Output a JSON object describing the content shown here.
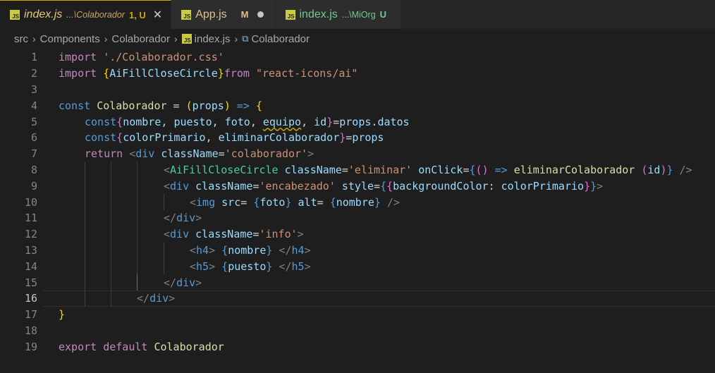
{
  "tabs": [
    {
      "file": "index.js",
      "path": "...\\Colaborador",
      "status": "1, U",
      "active": true
    },
    {
      "file": "App.js",
      "status": "M",
      "active": false
    },
    {
      "file": "index.js",
      "path": "...\\MiOrg",
      "status": "U",
      "active": false
    }
  ],
  "breadcrumb": [
    "src",
    "Components",
    "Colaborador",
    "index.js",
    "Colaborador"
  ],
  "line_numbers": [
    "1",
    "2",
    "3",
    "4",
    "5",
    "6",
    "7",
    "8",
    "9",
    "10",
    "11",
    "12",
    "13",
    "14",
    "15",
    "16",
    "17",
    "18",
    "19"
  ],
  "current_line": "16",
  "code": {
    "l1": [
      "import",
      " ",
      "'./Colaborador.css'"
    ],
    "l2": [
      "import",
      " ",
      "{",
      "AiFillCloseCircle",
      "}",
      "from",
      " ",
      "\"react-icons/ai\""
    ],
    "l4": [
      "const",
      " ",
      "Colaborador",
      " = ",
      "(",
      "props",
      ")",
      " ",
      "=>",
      " ",
      "{"
    ],
    "l5": [
      "const",
      "{",
      "nombre",
      ", ",
      "puesto",
      ", ",
      "foto",
      ", ",
      "equipo",
      ", ",
      "id",
      "}",
      "=",
      "props",
      ".",
      "datos"
    ],
    "l6": [
      "const",
      "{",
      "colorPrimario",
      ", ",
      "eliminarColaborador",
      "}",
      "=",
      "props"
    ],
    "l7": [
      "return",
      " ",
      "<",
      "div",
      " ",
      "className",
      "=",
      "'colaborador'",
      ">"
    ],
    "l8": [
      "<",
      "AiFillCloseCircle",
      " ",
      "className",
      "=",
      "'eliminar'",
      " ",
      "onClick",
      "=",
      "{",
      "(",
      ")",
      " ",
      "=>",
      " ",
      "eliminarColaborador",
      " ",
      "(",
      "id",
      ")",
      "}",
      " ",
      "/>"
    ],
    "l9": [
      "<",
      "div",
      " ",
      "className",
      "=",
      "'encabezado'",
      " ",
      "style",
      "=",
      "{",
      "{",
      "backgroundColor",
      ": ",
      "colorPrimario",
      "}",
      "}",
      ">"
    ],
    "l10": [
      "<",
      "img",
      " ",
      "src",
      "= ",
      "{",
      "foto",
      "}",
      " ",
      "alt",
      "= ",
      "{",
      "nombre",
      "}",
      " ",
      "/>"
    ],
    "l11": [
      "</",
      "div",
      ">"
    ],
    "l12": [
      "<",
      "div",
      " ",
      "className",
      "=",
      "'info'",
      ">"
    ],
    "l13": [
      "<",
      "h4",
      ">",
      " ",
      "{",
      "nombre",
      "}",
      " ",
      "</",
      "h4",
      ">"
    ],
    "l14": [
      "<",
      "h5",
      ">",
      " ",
      "{",
      "puesto",
      "}",
      " ",
      "</",
      "h5",
      ">"
    ],
    "l15": [
      "</",
      "div",
      ">"
    ],
    "l16": [
      "</",
      "div",
      ">"
    ],
    "l17": [
      "}"
    ],
    "l19": [
      "export",
      " ",
      "default",
      " ",
      "Colaborador"
    ]
  }
}
